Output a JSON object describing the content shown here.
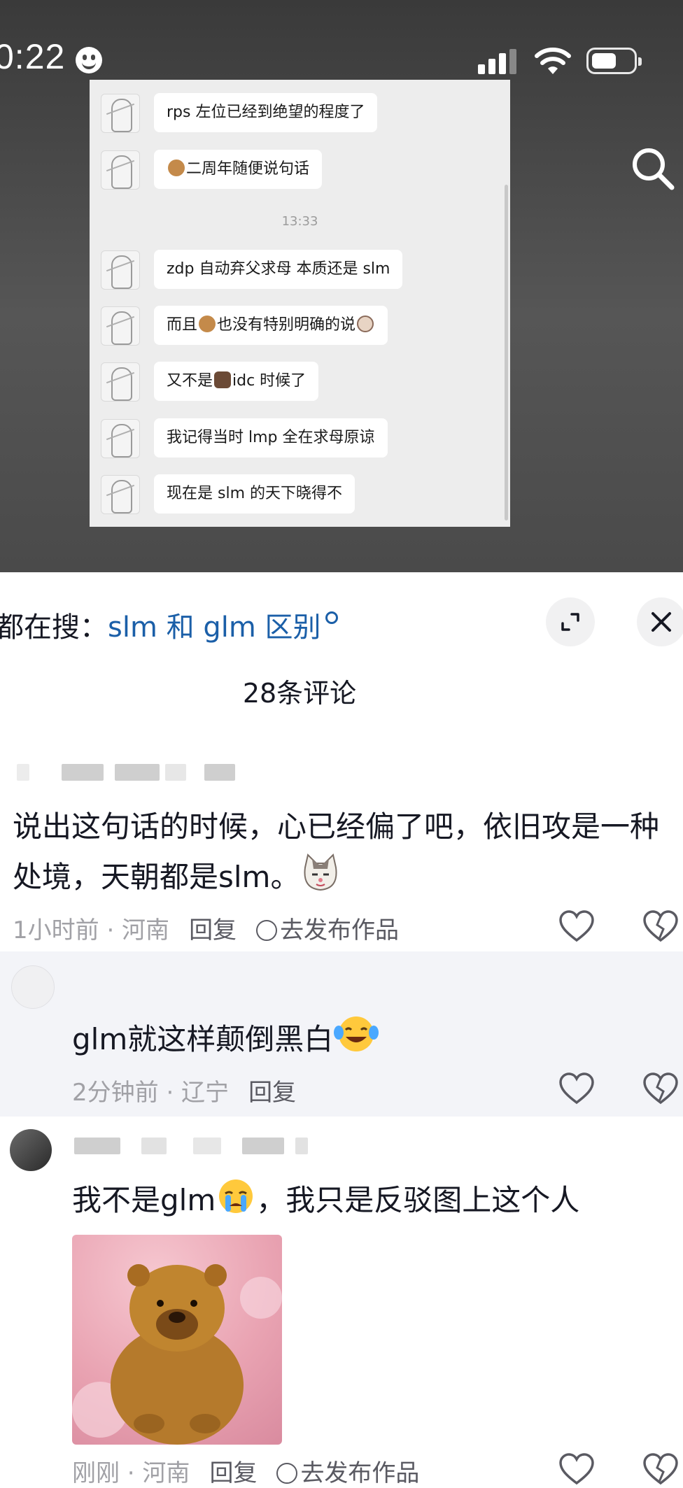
{
  "status_bar": {
    "time": "0:22"
  },
  "shared_image": {
    "messages": [
      {
        "text": "rps 左位已经到绝望的程度了"
      },
      {
        "text": "二周年随便说句话",
        "emoji_before": "monkey-emoji"
      },
      {
        "text": "zdp 自动弃父求母 本质还是 slm"
      },
      {
        "text": "而且",
        "text2": "也没有特别明确的说",
        "emoji_mid": "monkey-emoji",
        "emoji_end": "cow-emoji"
      },
      {
        "text": "又不是",
        "text2": "idc 时候了",
        "emoji_mid": "log-emoji"
      },
      {
        "text": "我记得当时 lmp 全在求母原谅"
      },
      {
        "text": "现在是 slm 的天下晓得不"
      }
    ],
    "timestamp": "13:33"
  },
  "search_hint": {
    "prefix": "都在搜：",
    "query": "slm 和 glm 区别"
  },
  "comments_header": {
    "count_label": "28条评论"
  },
  "comments": [
    {
      "text": "说出这句话的时候，心已经偏了吧，依旧攻是一种处境，天朝都是slm。",
      "emoji": "cat-emoji",
      "meta": "1小时前 · 河南",
      "reply_label": "回复",
      "publish_label": "去发布作品"
    },
    {
      "text": "glm就这样颠倒黑白",
      "emoji": "laughing-tears-emoji",
      "meta": "2分钟前 · 辽宁",
      "reply_label": "回复"
    },
    {
      "text_before": "我不是glm",
      "emoji": "crying-emoji",
      "text_after": "，我只是反驳图上这个人",
      "meta": "刚刚 · 河南",
      "reply_label": "回复",
      "publish_label": "去发布作品",
      "image_alt": "bear-sticker"
    }
  ],
  "colors": {
    "link": "#1b5fa8",
    "meta": "#a1a1a6",
    "sub_comment_bg": "#f3f4f8"
  }
}
